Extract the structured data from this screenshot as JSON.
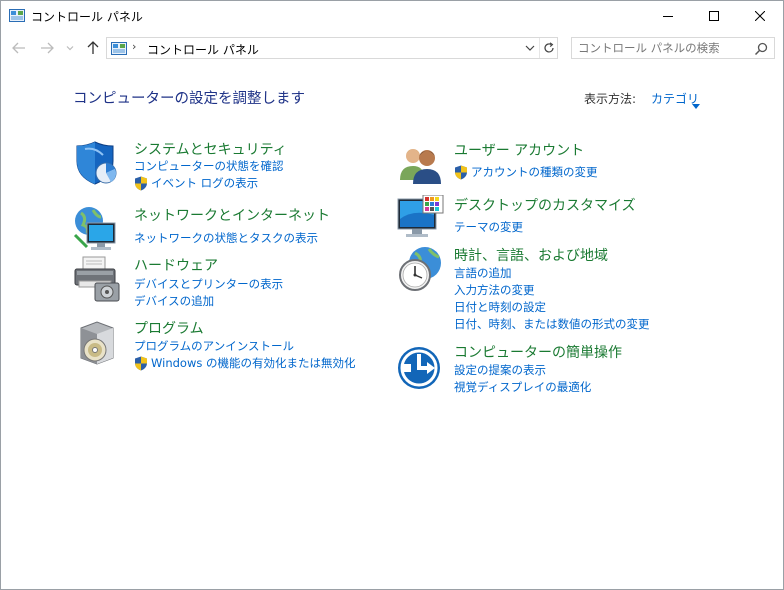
{
  "window": {
    "title": "コントロール パネル"
  },
  "address": {
    "path": "コントロール パネル",
    "sep": "›"
  },
  "search": {
    "placeholder": "コントロール パネルの検索"
  },
  "header": {
    "title": "コンピューターの設定を調整します",
    "view_label": "表示方法:",
    "view_value": "カテゴリ"
  },
  "categories": [
    {
      "title": "システムとセキュリティ",
      "links": [
        "コンピューターの状態を確認",
        "イベント ログの表示"
      ]
    },
    {
      "title": "ネットワークとインターネット",
      "links": [
        "ネットワークの状態とタスクの表示"
      ]
    },
    {
      "title": "ハードウェア",
      "links": [
        "デバイスとプリンターの表示",
        "デバイスの追加"
      ]
    },
    {
      "title": "プログラム",
      "links": [
        "プログラムのアンインストール",
        "Windows の機能の有効化または無効化"
      ]
    },
    {
      "title": "ユーザー アカウント",
      "links": [
        "アカウントの種類の変更"
      ]
    },
    {
      "title": "デスクトップのカスタマイズ",
      "links": [
        "テーマの変更"
      ]
    },
    {
      "title": "時計、言語、および地域",
      "links": [
        "言語の追加",
        "入力方法の変更",
        "日付と時刻の設定",
        "日付、時刻、または数値の形式の変更"
      ]
    },
    {
      "title": "コンピューターの簡単操作",
      "links": [
        "設定の提案の表示",
        "視覚ディスプレイの最適化"
      ]
    }
  ],
  "colors": {
    "title_blue": "#1e3287",
    "category_green": "#1a7a32",
    "link_blue": "#0066cc"
  }
}
